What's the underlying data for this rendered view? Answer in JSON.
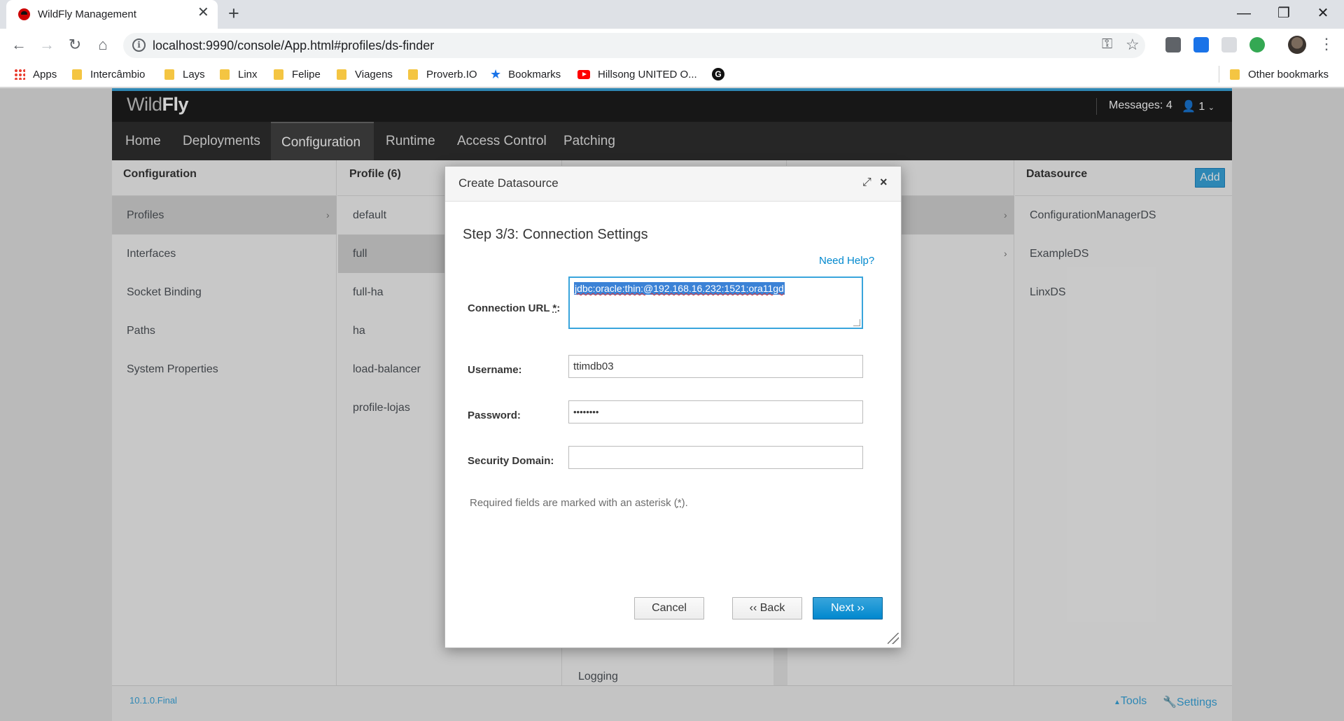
{
  "browser": {
    "tab_title": "WildFly Management",
    "tab_close": "✕",
    "new_tab": "+",
    "url": "localhost:9990/console/App.html#profiles/ds-finder",
    "window_controls": {
      "minimize": "—",
      "maximize": "❐",
      "close": "✕"
    },
    "bookmarks": [
      {
        "label": "Apps",
        "icon": "apps-grid-icon"
      },
      {
        "label": "Intercâmbio",
        "icon": "folder-icon"
      },
      {
        "label": "Lays",
        "icon": "folder-icon"
      },
      {
        "label": "Linx",
        "icon": "folder-icon"
      },
      {
        "label": "Felipe",
        "icon": "folder-icon"
      },
      {
        "label": "Viagens",
        "icon": "folder-icon"
      },
      {
        "label": "Proverb.IO",
        "icon": "folder-icon"
      },
      {
        "label": "Bookmarks",
        "icon": "star-icon"
      },
      {
        "label": "Hillsong UNITED O...",
        "icon": "youtube-icon"
      },
      {
        "label": "",
        "icon": "g-icon"
      }
    ],
    "other_bookmarks": "Other bookmarks"
  },
  "app": {
    "logo_light": "Wild",
    "logo_bold": "Fly",
    "messages": "Messages: 4",
    "user": "1",
    "nav": [
      "Home",
      "Deployments",
      "Configuration",
      "Runtime",
      "Access Control",
      "Patching"
    ],
    "active_nav": "Configuration",
    "columns": {
      "configuration": {
        "header": "Configuration",
        "items": [
          "Profiles",
          "Interfaces",
          "Socket Binding",
          "Paths",
          "System Properties"
        ]
      },
      "profile": {
        "header": "Profile (6)",
        "items": [
          "default",
          "full",
          "full-ha",
          "ha",
          "load-balancer",
          "profile-lojas"
        ]
      },
      "subsystem": {
        "visible_item": "Logging"
      },
      "datasource": {
        "header": "Datasource",
        "add_label": "Add",
        "items": [
          "ConfigurationManagerDS",
          "ExampleDS",
          "LinxDS"
        ]
      }
    },
    "footer": {
      "version": "10.1.0.Final",
      "tools": "Tools",
      "settings": "Settings"
    }
  },
  "modal": {
    "title": "Create Datasource",
    "step_title": "Step 3/3: Connection Settings",
    "need_help": "Need Help?",
    "fields": {
      "connection_url_label": "Connection URL",
      "connection_url_value": "jdbc:oracle:thin:@192.168.16.232:1521:ora11gd",
      "username_label": "Username:",
      "username_value": "ttimdb03",
      "password_label": "Password:",
      "password_value": "••••••••",
      "security_domain_label": "Security Domain:",
      "security_domain_value": ""
    },
    "required_note_prefix": "Required fields are marked with an asterisk (",
    "required_note_star": "*",
    "required_note_suffix": ").",
    "buttons": {
      "cancel": "Cancel",
      "back": "‹‹ Back",
      "next": "Next ››"
    }
  },
  "colors": {
    "accent": "#39a5dc",
    "primary_button": "#0088ce",
    "header_bg": "#1d1d1d",
    "nav_bg": "#2f2f2f"
  }
}
